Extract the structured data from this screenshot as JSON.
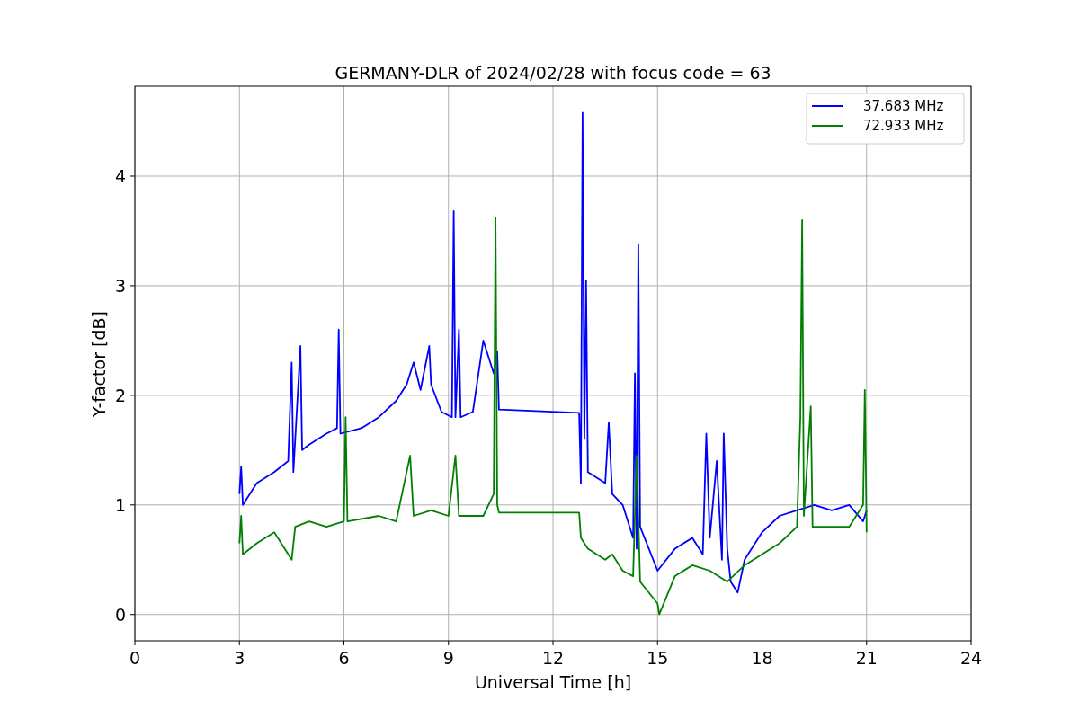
{
  "figure": {
    "chart_data": {
      "type": "line",
      "title": "GERMANY-DLR of 2024/02/28 with focus code = 63",
      "xlabel": "Universal Time [h]",
      "ylabel": "Y-factor [dB]",
      "xlim": [
        0,
        24
      ],
      "ylim": [
        -0.24,
        4.82
      ],
      "xticks": [
        0,
        3,
        6,
        9,
        12,
        15,
        18,
        21,
        24
      ],
      "yticks": [
        0,
        1,
        2,
        3,
        4
      ],
      "grid": true,
      "legend": true,
      "series": [
        {
          "name": "37.683 MHz",
          "color": "#0000ff",
          "x": [
            3.0,
            3.05,
            3.1,
            3.5,
            4.0,
            4.4,
            4.5,
            4.55,
            4.75,
            4.8,
            5.0,
            5.5,
            5.8,
            5.85,
            5.9,
            6.5,
            7.0,
            7.5,
            7.8,
            8.0,
            8.2,
            8.45,
            8.5,
            8.8,
            9.1,
            9.15,
            9.2,
            9.3,
            9.35,
            9.7,
            10.0,
            10.3,
            10.4,
            10.45,
            12.75,
            12.8,
            12.85,
            12.9,
            12.95,
            13.0,
            13.5,
            13.6,
            13.7,
            14.0,
            14.3,
            14.35,
            14.4,
            14.45,
            14.5,
            15.0,
            15.5,
            16.0,
            16.3,
            16.4,
            16.5,
            16.7,
            16.85,
            16.9,
            17.0,
            17.1,
            17.3,
            17.5,
            18.0,
            18.5,
            19.0,
            19.5,
            20.0,
            20.5,
            20.9,
            21.0
          ],
          "values": [
            1.1,
            1.35,
            1.0,
            1.2,
            1.3,
            1.4,
            2.3,
            1.3,
            2.45,
            1.5,
            1.55,
            1.65,
            1.7,
            2.6,
            1.65,
            1.7,
            1.8,
            1.95,
            2.1,
            2.3,
            2.05,
            2.45,
            2.1,
            1.85,
            1.8,
            3.68,
            1.8,
            2.6,
            1.8,
            1.85,
            2.5,
            2.2,
            2.4,
            1.87,
            1.84,
            1.2,
            4.58,
            1.6,
            3.05,
            1.3,
            1.2,
            1.75,
            1.1,
            1.0,
            0.7,
            2.2,
            0.6,
            3.38,
            0.8,
            0.4,
            0.6,
            0.7,
            0.55,
            1.65,
            0.7,
            1.4,
            0.5,
            1.65,
            0.6,
            0.3,
            0.2,
            0.5,
            0.75,
            0.9,
            0.95,
            1.0,
            0.95,
            1.0,
            0.85,
            0.95
          ]
        },
        {
          "name": "72.933 MHz",
          "color": "#008000",
          "x": [
            3.0,
            3.05,
            3.1,
            3.5,
            4.0,
            4.5,
            4.6,
            5.0,
            5.5,
            6.0,
            6.05,
            6.1,
            7.0,
            7.5,
            7.9,
            8.0,
            8.5,
            9.0,
            9.2,
            9.3,
            10.0,
            10.3,
            10.35,
            10.4,
            10.45,
            12.75,
            12.8,
            13.0,
            13.5,
            13.7,
            14.0,
            14.3,
            14.4,
            14.5,
            15.0,
            15.05,
            15.5,
            16.0,
            16.5,
            17.0,
            17.5,
            18.0,
            18.5,
            19.0,
            19.1,
            19.15,
            19.2,
            19.4,
            19.45,
            20.0,
            20.5,
            20.9,
            20.95,
            21.0
          ],
          "values": [
            0.65,
            0.9,
            0.55,
            0.65,
            0.75,
            0.5,
            0.8,
            0.85,
            0.8,
            0.85,
            1.8,
            0.85,
            0.9,
            0.85,
            1.45,
            0.9,
            0.95,
            0.9,
            1.45,
            0.9,
            0.9,
            1.1,
            3.62,
            1.0,
            0.93,
            0.93,
            0.7,
            0.6,
            0.5,
            0.55,
            0.4,
            0.35,
            1.45,
            0.3,
            0.1,
            0.0,
            0.35,
            0.45,
            0.4,
            0.3,
            0.45,
            0.55,
            0.65,
            0.8,
            1.8,
            3.6,
            0.9,
            1.9,
            0.8,
            0.8,
            0.8,
            1.0,
            2.05,
            0.75
          ]
        }
      ]
    }
  }
}
